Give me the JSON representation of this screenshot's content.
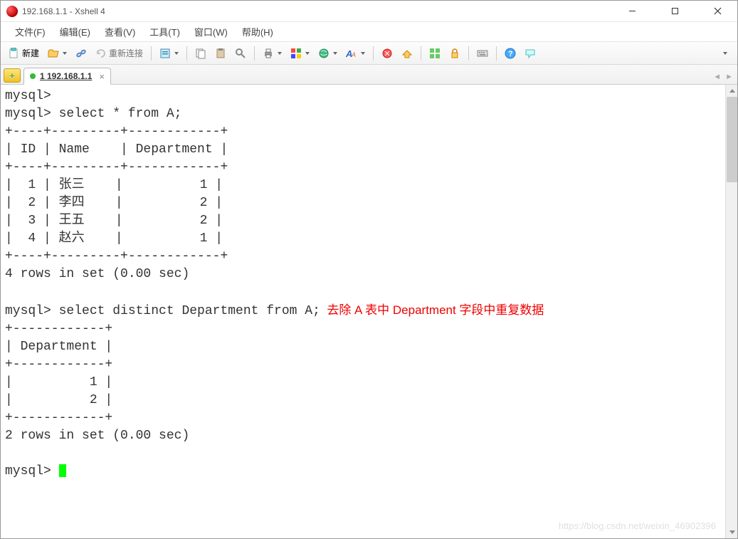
{
  "window": {
    "title": "192.168.1.1 - Xshell 4"
  },
  "menu": {
    "file": "文件(F)",
    "edit": "编辑(E)",
    "view": "查看(V)",
    "tools": "工具(T)",
    "window": "窗口(W)",
    "help": "帮助(H)"
  },
  "toolbar": {
    "new": "新建",
    "reconnect": "重新连接"
  },
  "tabs": {
    "tab1": "1 192.168.1.1",
    "close": "×"
  },
  "terminal": {
    "line01": "mysql>",
    "line02": "mysql> select * from A;",
    "line03": "+----+---------+------------+",
    "line04": "| ID | Name    | Department |",
    "line05": "+----+---------+------------+",
    "line06": "|  1 | 张三    |          1 |",
    "line07": "|  2 | 李四    |          2 |",
    "line08": "|  3 | 王五    |          2 |",
    "line09": "|  4 | 赵六    |          1 |",
    "line10": "+----+---------+------------+",
    "line11": "4 rows in set (0.00 sec)",
    "line12": "",
    "line13a": "mysql> select distinct Department from A;",
    "annotation": "  去除 A 表中 Department 字段中重复数据",
    "line14": "+------------+",
    "line15": "| Department |",
    "line16": "+------------+",
    "line17": "|          1 |",
    "line18": "|          2 |",
    "line19": "+------------+",
    "line20": "2 rows in set (0.00 sec)",
    "line21": "",
    "prompt": "mysql> "
  },
  "watermark": "https://blog.csdn.net/weixin_46902396",
  "query_data": {
    "table_A": {
      "columns": [
        "ID",
        "Name",
        "Department"
      ],
      "rows": [
        {
          "ID": 1,
          "Name": "张三",
          "Department": 1
        },
        {
          "ID": 2,
          "Name": "李四",
          "Department": 2
        },
        {
          "ID": 3,
          "Name": "王五",
          "Department": 2
        },
        {
          "ID": 4,
          "Name": "赵六",
          "Department": 1
        }
      ],
      "result_msg": "4 rows in set (0.00 sec)"
    },
    "distinct_query": {
      "column": "Department",
      "values": [
        1,
        2
      ],
      "result_msg": "2 rows in set (0.00 sec)"
    }
  }
}
